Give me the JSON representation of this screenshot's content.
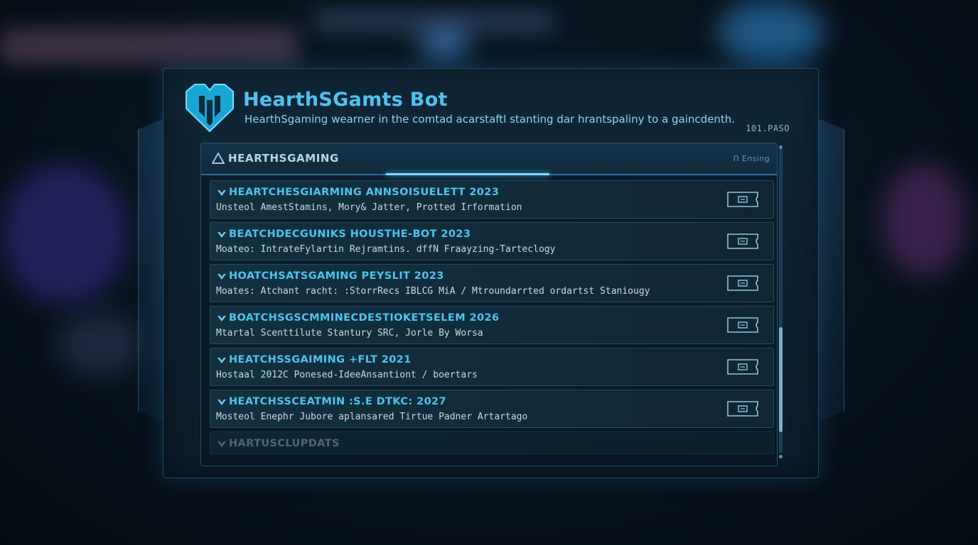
{
  "app": {
    "title": "HearthSGamts Bot",
    "subtitle": "HearthSgaming wearner in the comtad acarstaftl stanting dar hrantspaliny to a gaincdenth.",
    "corner_tag": "101.PASO"
  },
  "list": {
    "header_title": "HEARTHSGAMING",
    "header_status": "Ո Ensing",
    "items": [
      {
        "title": "HEARTCHESGIARMING ANNSOISUELETT 2023",
        "desc": "Unsteol  AmestStamins, Mory& Jatter, Protted Irformation",
        "icon": "chevron-emblem-icon",
        "action": "ticket-icon"
      },
      {
        "title": "BEATCHDECGUNIKS HOUSTHE-BOT 2023",
        "desc": "Moateo:  IntrateFylartin Rejramtins. dffN Fraayzing-Tarteclogy",
        "icon": "chevron-emblem-icon",
        "action": "ticket-icon"
      },
      {
        "title": "HOATCHSATSGAMING PEYSLIT 2023",
        "desc": "Moates:  Atchant racht: :StorrRecs IBLCG MiA  /  Mtroundarrted ordartst Staniougy",
        "icon": "chevron-emblem-icon",
        "action": "ticket-icon"
      },
      {
        "title": "BOATCHSGSCMMINECDESTIOKETSELEM 2026",
        "desc": "Mtartal  Scenttilute Stantury SRC, Jorle By Worsa",
        "icon": "chevron-emblem-icon",
        "action": "ticket-icon"
      },
      {
        "title": "HEATCHSSGAIMING +FLT 2021",
        "desc": "Hostaal  2012C Ponesed-IdeeAnsantiont / boertars",
        "icon": "chevron-emblem-icon",
        "action": "ticket-icon"
      },
      {
        "title": "HEATCHSSCEATMIN :S.E DTKC: 2027",
        "desc": "Mosteol  Enephr Jubore aplansared Tirtue Padner Artartago",
        "icon": "chevron-emblem-icon",
        "action": "ticket-icon"
      }
    ],
    "faded_item": {
      "title": "HARTUSCLUPDATS",
      "icon": "chevron-emblem-icon"
    }
  },
  "colors": {
    "accent": "#4cc4f0",
    "panel": "#0f2637",
    "border": "#214a62"
  }
}
